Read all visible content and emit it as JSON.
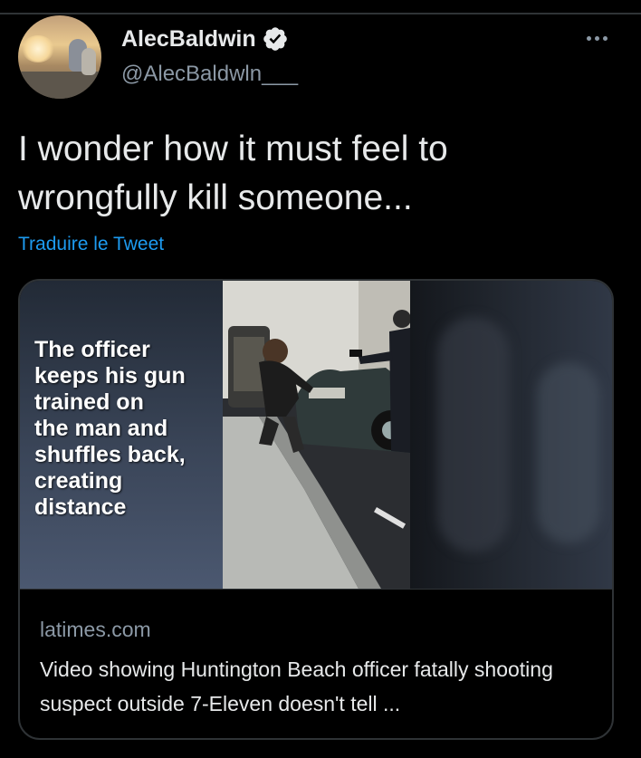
{
  "author": {
    "name": "AlecBaldwin",
    "handle": "@AlecBaldwln___",
    "verified": true
  },
  "tweet": {
    "text": "I wonder how it must feel to wrongfully kill someone...",
    "translate_label": "Traduire le Tweet"
  },
  "card": {
    "caption": "The officer\nkeeps his gun\ntrained on\nthe man and\nshuffles back,\ncreating\ndistance",
    "domain": "latimes.com",
    "headline": "Video showing Huntington Beach officer fatally shooting suspect outside 7-Eleven doesn't tell ..."
  },
  "icons": {
    "verified": "verified-badge-icon",
    "more": "more-options-icon"
  },
  "colors": {
    "background": "#000000",
    "text_primary": "#e7e9ea",
    "text_secondary": "#8b98a5",
    "link": "#1d9bf0",
    "border": "#2f3336"
  }
}
